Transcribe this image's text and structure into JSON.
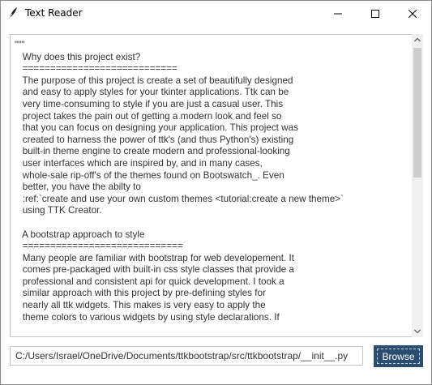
{
  "window": {
    "title": "Text Reader",
    "controls": {
      "minimize": "minimize-icon",
      "maximize": "maximize-icon",
      "close": "close-icon"
    }
  },
  "text_area": {
    "content": "\"\"\"\n   Why does this project exist?\n   ============================\n   The purpose of this project is create a set of beautifully designed\n   and easy to apply styles for your tkinter applications. Ttk can be\n   very time-consuming to style if you are just a casual user. This\n   project takes the pain out of getting a modern look and feel so\n   that you can focus on designing your application. This project was\n   created to harness the power of ttk's (and thus Python's) existing\n   built-in theme engine to create modern and professional-looking\n   user interfaces which are inspired by, and in many cases,\n   whole-sale rip-off's of the themes found on Bootswatch_. Even\n   better, you have the abilty to\n   :ref:`create and use your own custom themes <tutorial:create a new theme>`\n   using TTK Creator.\n\n   A bootstrap approach to style\n   =============================\n   Many people are familiar with bootstrap for web developement. It\n   comes pre-packaged with built-in css style classes that provide a\n   professional and consistent api for quick development. I took a\n   similar approach with this project by pre-defining styles for\n   nearly all ttk widgets. This makes is very easy to apply the\n   theme colors to various widgets by using style declarations. If"
  },
  "path_field": {
    "value": "C:/Users/Israel/OneDrive/Documents/ttkbootstrap/src/ttkbootstrap/__init__.py"
  },
  "browse_button": {
    "label": "Browse"
  },
  "colors": {
    "accent": "#2b4d6f",
    "text": "#333333",
    "border": "#c5c5c5",
    "scroll_thumb": "#cdcdcd"
  }
}
